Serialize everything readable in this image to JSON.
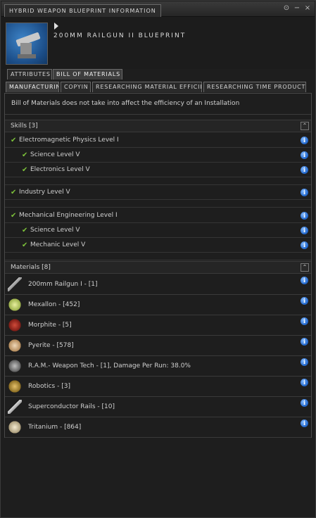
{
  "window": {
    "title": "HYBRID WEAPON BLUEPRINT INFORMATION",
    "controls": [
      "⊙",
      "−",
      "×"
    ]
  },
  "header": {
    "item_name": "200MM RAILGUN II BLUEPRINT",
    "icon": "railgun-blueprint-icon"
  },
  "tabs_top": [
    "ATTRIBUTES",
    "BILL OF MATERIALS"
  ],
  "tabs_bottom": [
    "MANUFACTURING",
    "COPYIN",
    "RESEARCHING MATERIAL EFFICIE",
    "RESEARCHING TIME PRODUCTI"
  ],
  "active_tab_top": "BILL OF MATERIALS",
  "active_tab_bottom": "MANUFACTURING",
  "note": "Bill of Materials does not take into affect the efficiency of an Installation",
  "skills": {
    "header": "Skills [3]",
    "groups": [
      {
        "name": "Electromagnetic Physics Level I",
        "sub": [
          "Science Level V",
          "Electronics Level V"
        ]
      },
      {
        "name": "Industry Level V",
        "sub": []
      },
      {
        "name": "Mechanical Engineering Level I",
        "sub": [
          "Science Level V",
          "Mechanic Level V"
        ]
      }
    ]
  },
  "materials": {
    "header": "Materials [8]",
    "items": [
      {
        "label": "200mm Railgun I - [1]",
        "icon": "railgun-icon"
      },
      {
        "label": "Mexallon - [452]",
        "icon": "mexallon-icon"
      },
      {
        "label": "Morphite - [5]",
        "icon": "morphite-icon"
      },
      {
        "label": "Pyerite - [578]",
        "icon": "pyerite-icon"
      },
      {
        "label": "R.A.M.- Weapon Tech - [1], Damage Per Run: 38.0%",
        "icon": "ram-weapon-tech-icon"
      },
      {
        "label": "Robotics - [3]",
        "icon": "robotics-icon"
      },
      {
        "label": "Superconductor Rails - [10]",
        "icon": "superconductor-rails-icon"
      },
      {
        "label": "Tritanium - [864]",
        "icon": "tritanium-icon"
      }
    ]
  },
  "colors": {
    "check": "#7cc13a",
    "info": "#1e63c8",
    "bg": "#1e1e1e"
  }
}
